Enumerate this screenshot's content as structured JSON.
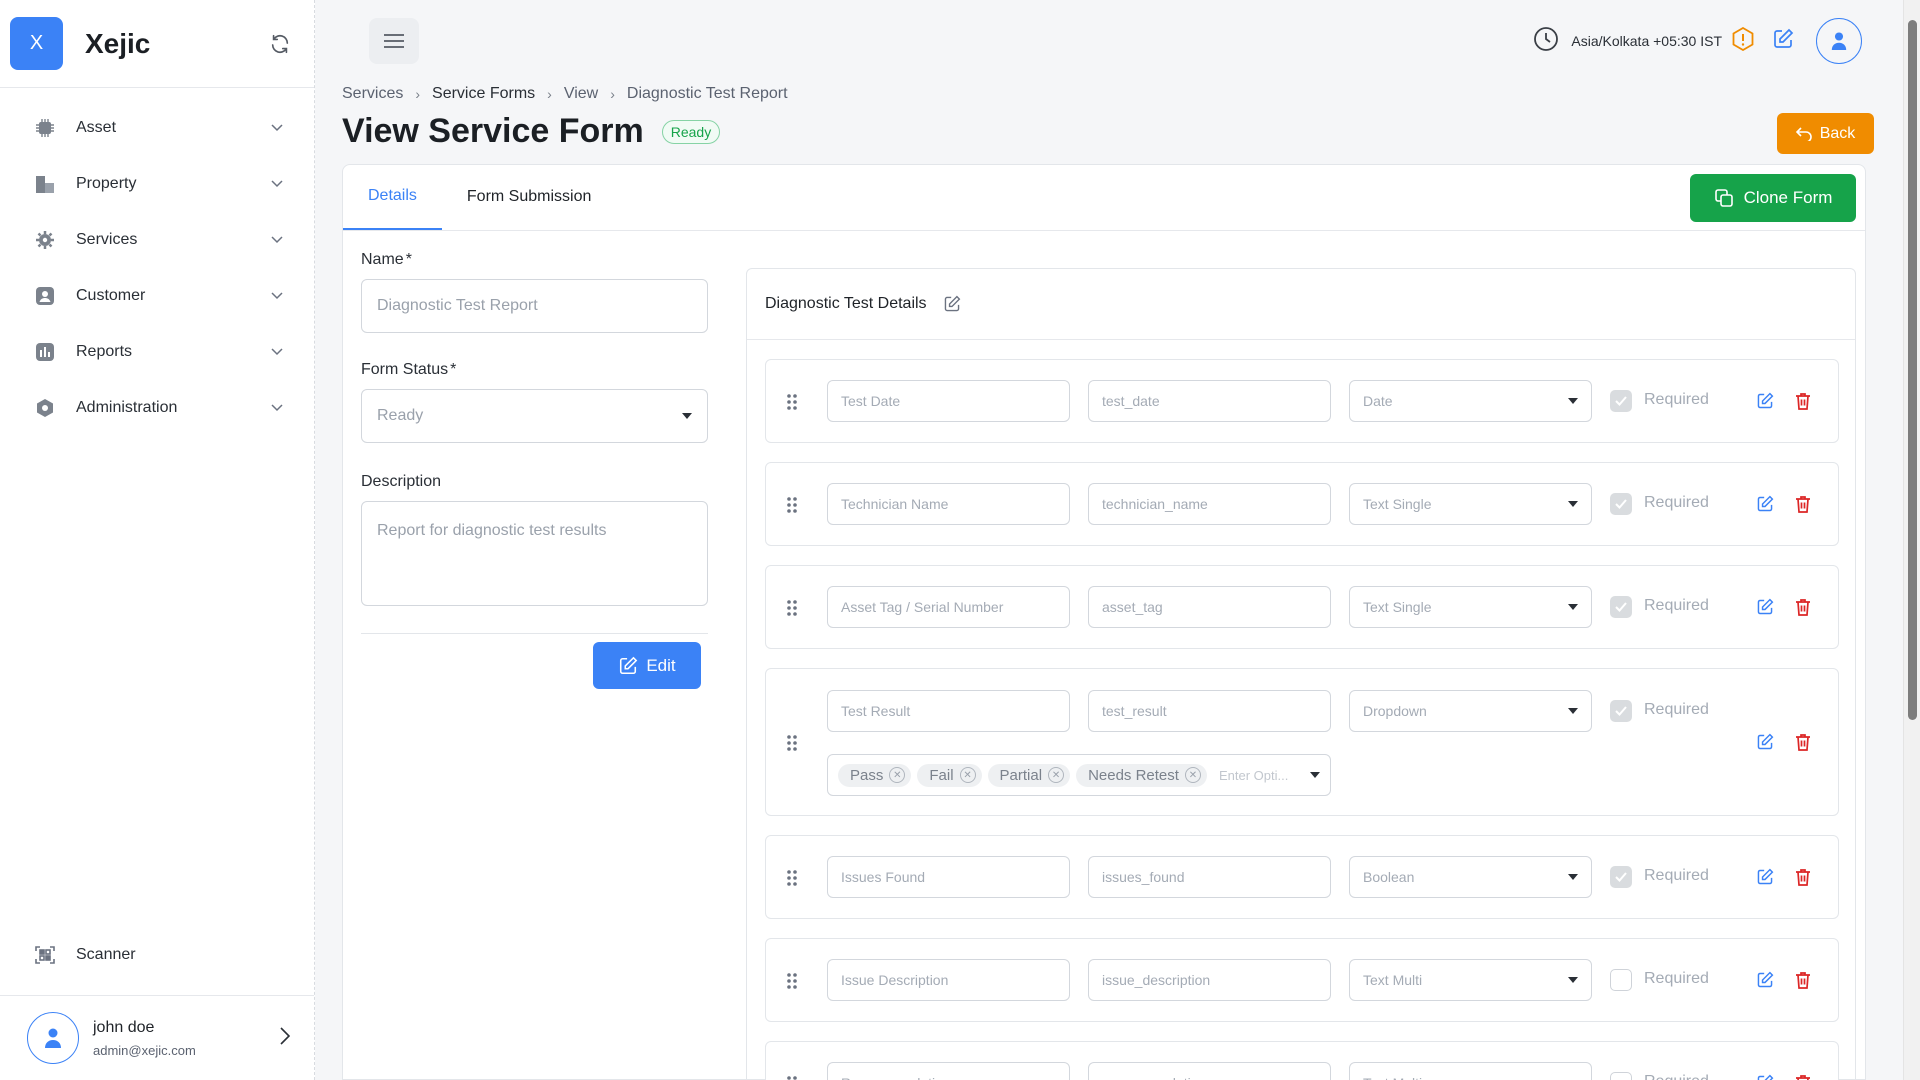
{
  "brand": {
    "logo_letter": "X",
    "name": "Xejic"
  },
  "sidebar": {
    "items": [
      {
        "label": "Asset",
        "icon": "chip-icon"
      },
      {
        "label": "Property",
        "icon": "building-icon"
      },
      {
        "label": "Services",
        "icon": "gear-icon"
      },
      {
        "label": "Customer",
        "icon": "user-icon"
      },
      {
        "label": "Reports",
        "icon": "chart-icon"
      },
      {
        "label": "Administration",
        "icon": "shield-icon"
      }
    ],
    "scanner_label": "Scanner"
  },
  "user": {
    "name": "john doe",
    "email": "admin@xejic.com"
  },
  "topbar": {
    "timezone": "Asia/Kolkata +05:30 IST"
  },
  "breadcrumb": [
    "Services",
    "Service Forms",
    "View",
    "Diagnostic Test Report"
  ],
  "page": {
    "title": "View Service Form",
    "status_badge": "Ready",
    "back_label": "Back"
  },
  "tabs": [
    {
      "label": "Details",
      "active": true
    },
    {
      "label": "Form Submission",
      "active": false
    }
  ],
  "clone_label": "Clone Form",
  "form": {
    "name_label": "Name",
    "name_value": "Diagnostic Test Report",
    "status_label": "Form Status",
    "status_value": "Ready",
    "description_label": "Description",
    "description_value": "Report for diagnostic test results",
    "edit_label": "Edit",
    "required_marker": "*"
  },
  "panel": {
    "title": "Diagnostic Test Details",
    "required_label": "Required",
    "option_placeholder": "Enter Opti...",
    "fields": [
      {
        "label": "Test Date",
        "key": "test_date",
        "type": "Date",
        "required": true
      },
      {
        "label": "Technician Name",
        "key": "technician_name",
        "type": "Text Single",
        "required": true
      },
      {
        "label": "Asset Tag / Serial Number",
        "key": "asset_tag",
        "type": "Text Single",
        "required": true
      },
      {
        "label": "Test Result",
        "key": "test_result",
        "type": "Dropdown",
        "required": true,
        "options": [
          "Pass",
          "Fail",
          "Partial",
          "Needs Retest"
        ]
      },
      {
        "label": "Issues Found",
        "key": "issues_found",
        "type": "Boolean",
        "required": true
      },
      {
        "label": "Issue Description",
        "key": "issue_description",
        "type": "Text Multi",
        "required": false
      },
      {
        "label": "Recommendation",
        "key": "recommendation",
        "type": "Text Multi",
        "required": false
      }
    ]
  },
  "colors": {
    "primary": "#3b82f6",
    "success": "#16a34a",
    "warning": "#f08c00",
    "danger": "#dc2626"
  }
}
